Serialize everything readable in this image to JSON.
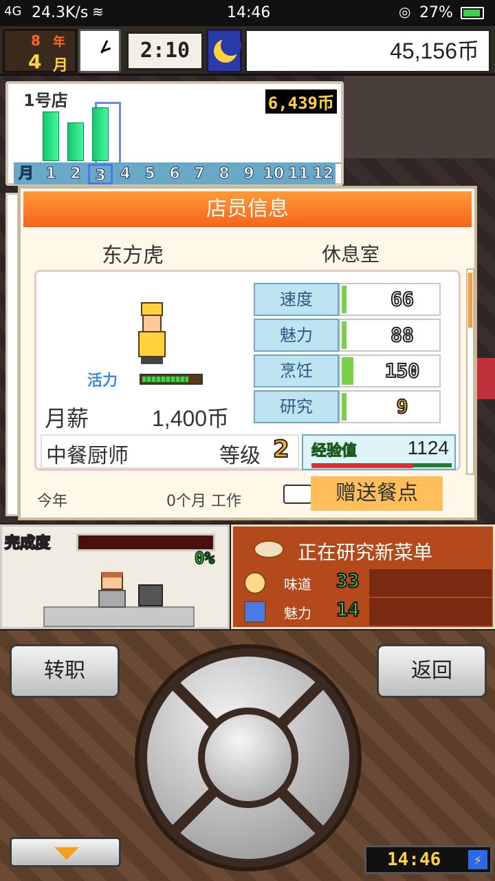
{
  "status_bar": {
    "signal": "4G",
    "net_speed": "24.3K/s",
    "time": "14:46",
    "battery": "27%"
  },
  "hud": {
    "year_num": "8",
    "year_label": "年",
    "month_num": "4",
    "month_label": "月",
    "game_time": "2:10",
    "money": "45,156币"
  },
  "shop_chart": {
    "title": "1号店",
    "earnings": "6,439币",
    "month_label": "月",
    "months": [
      "1",
      "2",
      "3",
      "4",
      "5",
      "6",
      "7",
      "8",
      "9",
      "10",
      "11",
      "12"
    ],
    "selected_month": "3"
  },
  "chart_data": {
    "type": "bar",
    "title": "1号店",
    "categories": [
      "1",
      "2",
      "3",
      "4",
      "5",
      "6",
      "7",
      "8",
      "9",
      "10",
      "11",
      "12"
    ],
    "values": [
      0.9,
      0.7,
      0.98,
      0,
      0,
      0,
      0,
      0,
      0,
      0,
      0,
      0
    ],
    "ylim": [
      0,
      1
    ]
  },
  "staff": {
    "header": "店员信息",
    "name": "东方虎",
    "location": "休息室",
    "vitality_label": "活力",
    "vitality_level": 0.8,
    "salary_label": "月薪",
    "salary_value": "1,400币",
    "stats": [
      {
        "label": "速度",
        "value": "66",
        "level": 0.05
      },
      {
        "label": "魅力",
        "value": "88",
        "level": 0.05
      },
      {
        "label": "烹饪",
        "value": "150",
        "level": 0.12
      },
      {
        "label": "研究",
        "value": "9",
        "level": 0.05
      }
    ],
    "job": "中餐厨师",
    "level_label": "等级",
    "level_value": "2",
    "exp_label": "经验值",
    "exp_value": "1124",
    "exp_progress": 0.72,
    "footer_year": "今年",
    "footer_work": "0个月 工作",
    "gift_button": "赠送餐点"
  },
  "kitchen": {
    "done_label": "完成度",
    "percent": "0%"
  },
  "research": {
    "title": "正在研究新菜单",
    "rows": [
      {
        "label": "味道",
        "value": "33"
      },
      {
        "label": "魅力",
        "value": "14"
      }
    ]
  },
  "controls": {
    "left_button": "转职",
    "right_button": "返回",
    "clock": "14:46"
  }
}
